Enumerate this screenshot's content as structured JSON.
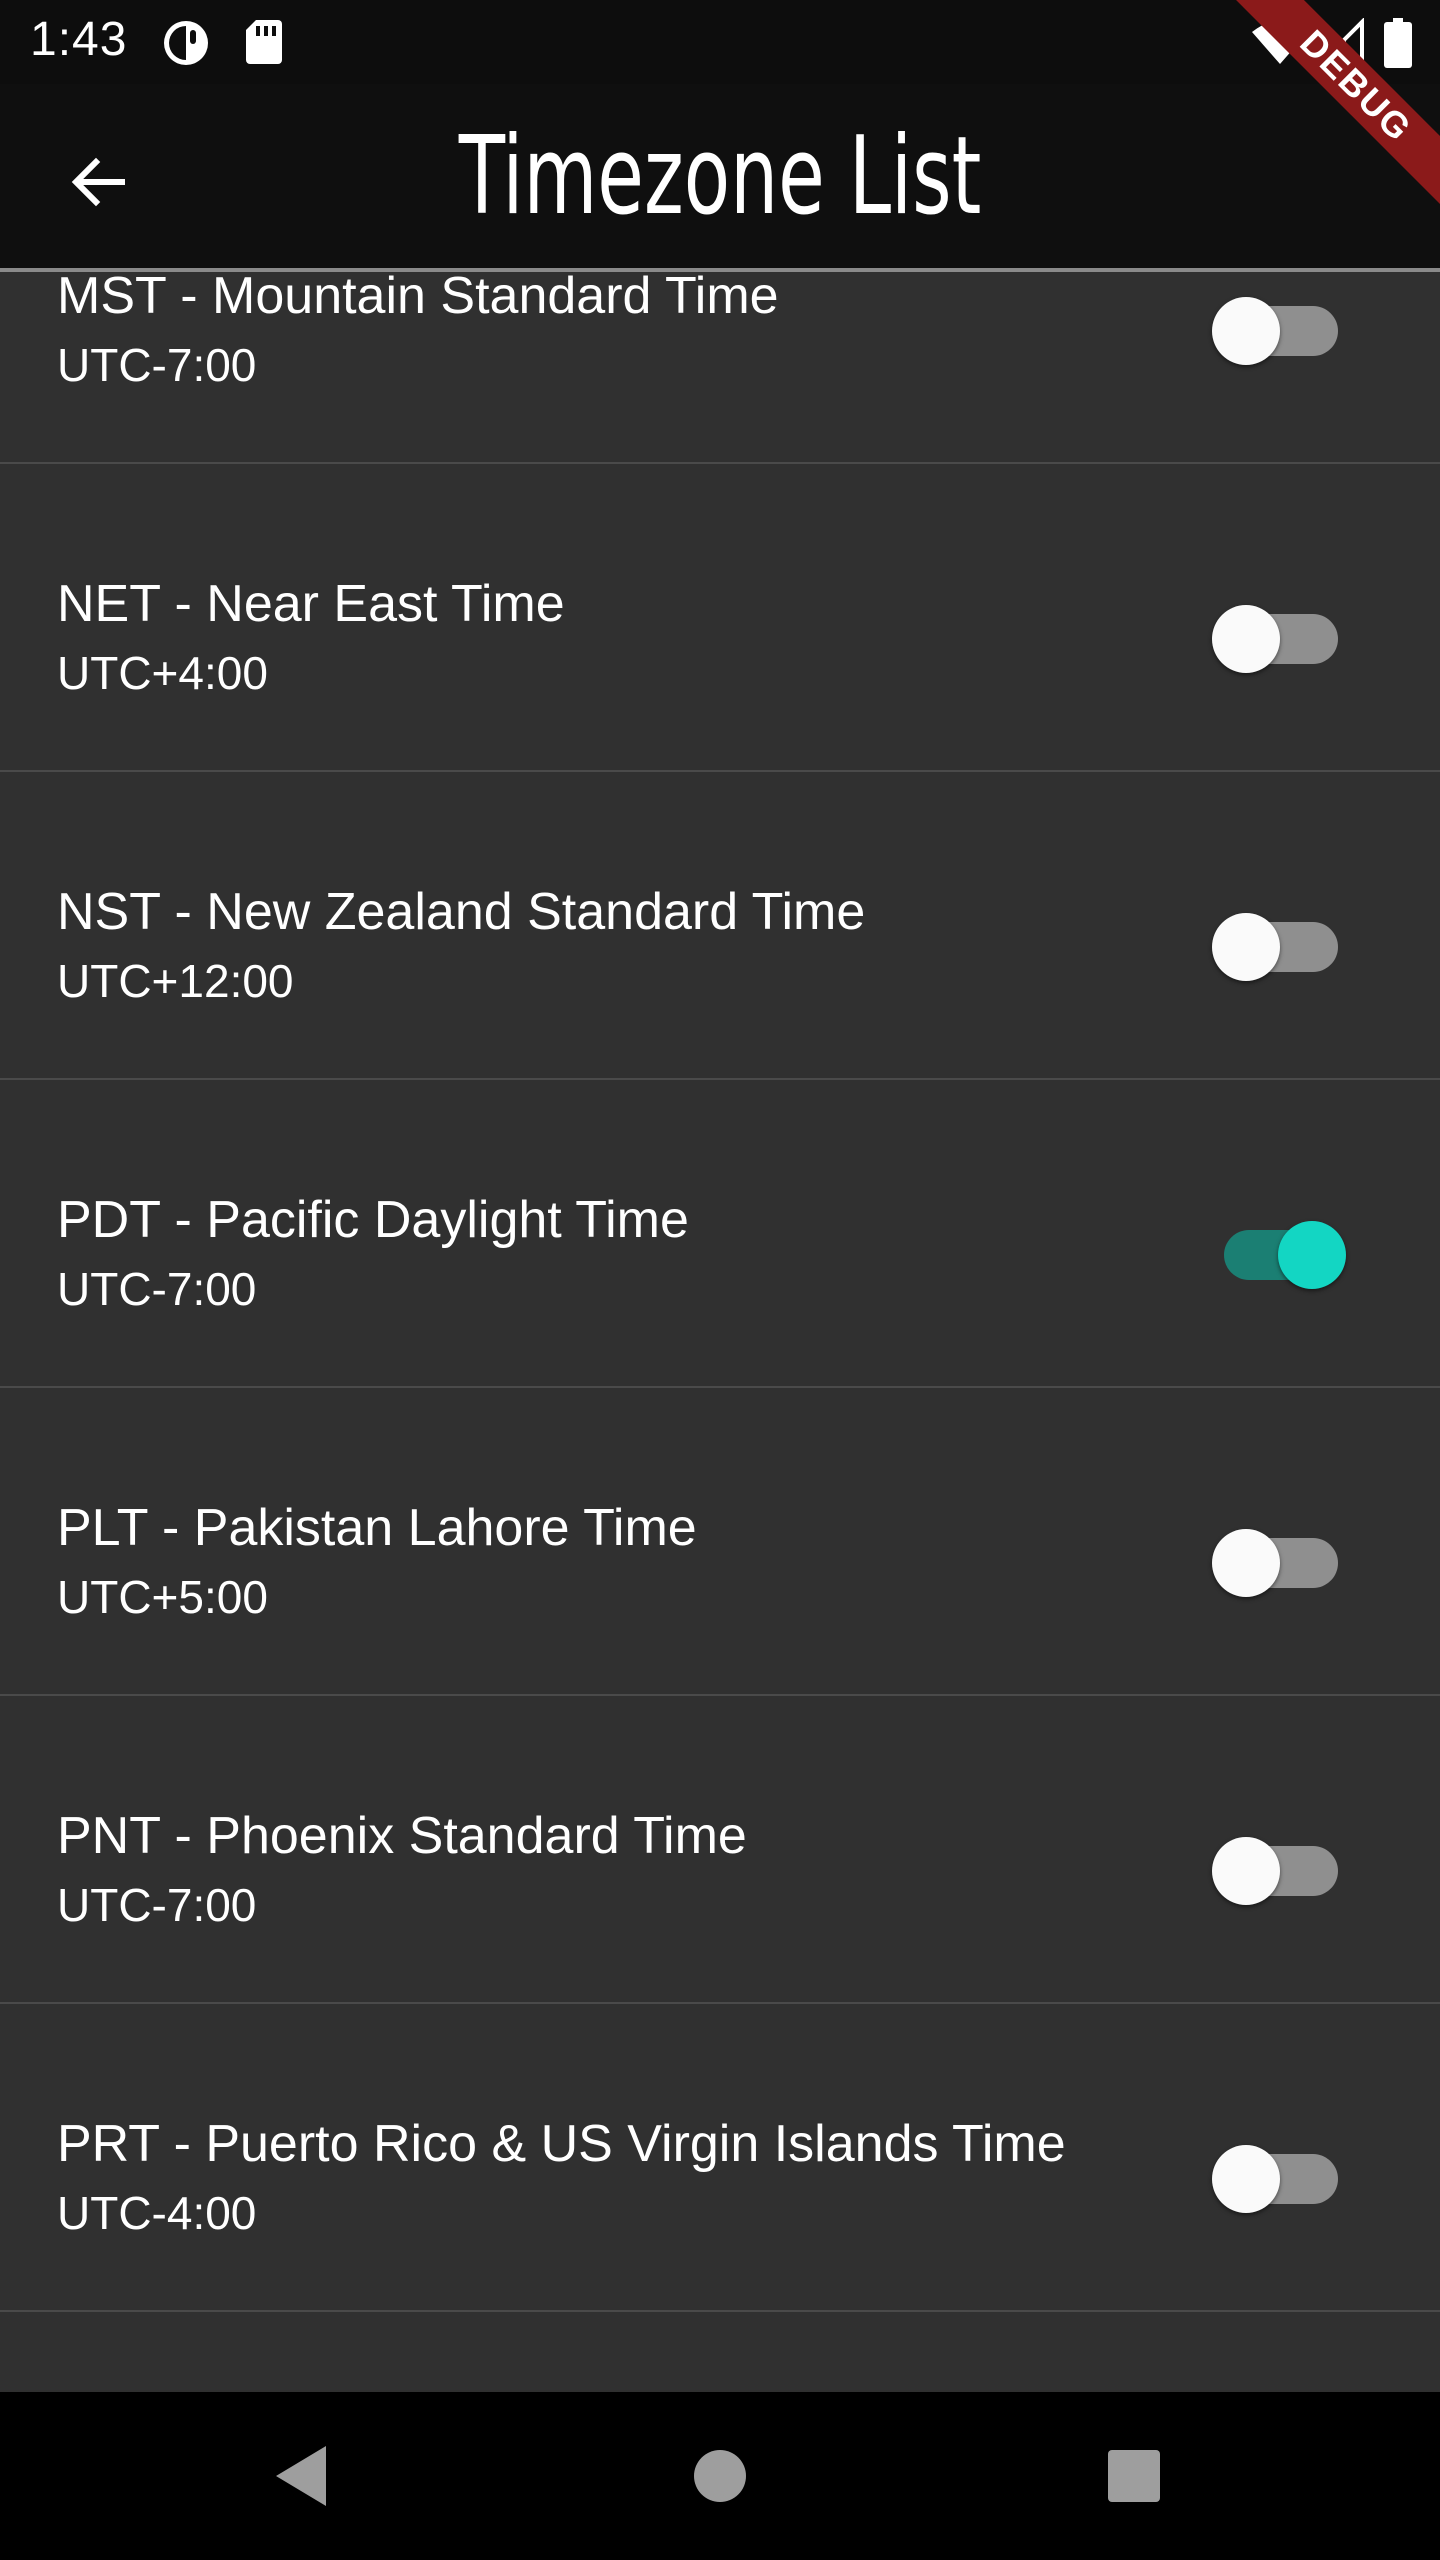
{
  "status_bar": {
    "time": "1:43",
    "left_icons": [
      "data-saver-icon",
      "sd-card-icon"
    ],
    "right_icons": [
      "wifi-icon",
      "signal-icon",
      "battery-icon"
    ]
  },
  "app_bar": {
    "title": "Timezone List",
    "back_icon": "arrow-back-icon"
  },
  "debug_banner": "DEBUG",
  "timezones": [
    {
      "title": "MST - Mountain Standard Time",
      "offset": "UTC-7:00",
      "enabled": false
    },
    {
      "title": "NET - Near East Time",
      "offset": "UTC+4:00",
      "enabled": false
    },
    {
      "title": "NST - New Zealand Standard Time",
      "offset": "UTC+12:00",
      "enabled": false
    },
    {
      "title": "PDT - Pacific Daylight Time",
      "offset": "UTC-7:00",
      "enabled": true
    },
    {
      "title": "PLT - Pakistan Lahore Time",
      "offset": "UTC+5:00",
      "enabled": false
    },
    {
      "title": "PNT - Phoenix Standard Time",
      "offset": "UTC-7:00",
      "enabled": false
    },
    {
      "title": "PRT - Puerto Rico & US Virgin Islands Time",
      "offset": "UTC-4:00",
      "enabled": false
    }
  ],
  "nav_bar": {
    "buttons": [
      "back-triangle-icon",
      "home-circle-icon",
      "recents-square-icon"
    ]
  },
  "colors": {
    "background": "#303030",
    "app_bar": "#0f0f0f",
    "switch_on_thumb": "#13d6c3",
    "switch_on_track": "#1b7f73",
    "switch_off_thumb": "#fafafa",
    "switch_off_track": "#8f8f8f",
    "debug_ribbon": "#8b1a1a"
  }
}
